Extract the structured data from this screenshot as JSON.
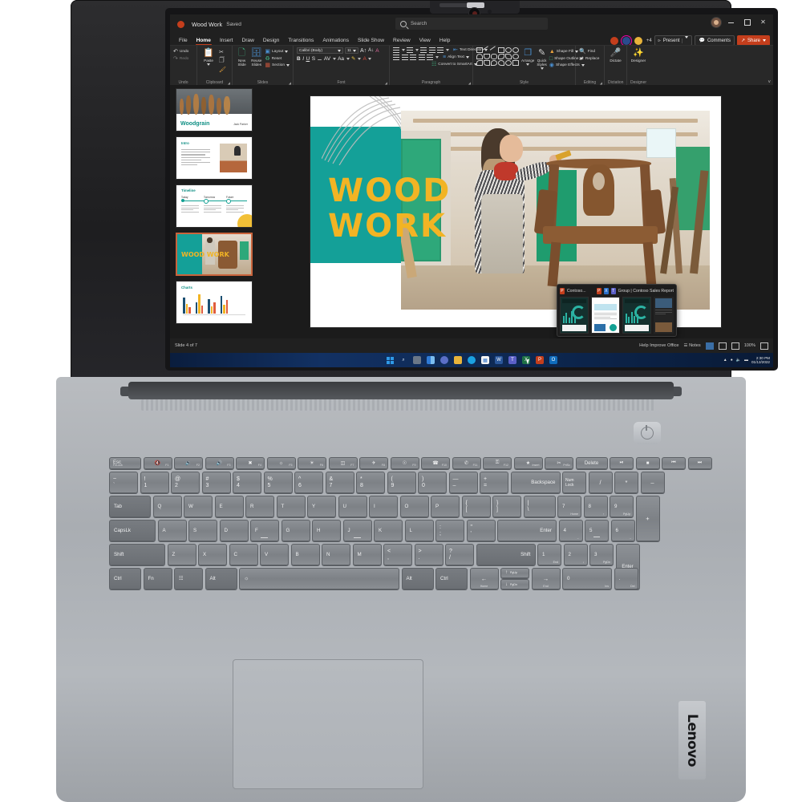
{
  "device": {
    "brand": "Lenovo",
    "webcam_icon": "webcam-icon",
    "power_button_icon": "power-icon"
  },
  "app": {
    "icon": "powerpoint-icon",
    "doc_title": "Wood Work",
    "save_state": "Saved",
    "search_placeholder": "Search",
    "search_icon": "search-icon",
    "window_controls": {
      "minimize": "–",
      "maximize": "□",
      "close": "×"
    },
    "account_avatar": "user-avatar"
  },
  "ribbon": {
    "tabs": [
      {
        "label": "File",
        "active": false
      },
      {
        "label": "Home",
        "active": true
      },
      {
        "label": "Insert",
        "active": false
      },
      {
        "label": "Draw",
        "active": false
      },
      {
        "label": "Design",
        "active": false
      },
      {
        "label": "Transitions",
        "active": false
      },
      {
        "label": "Animations",
        "active": false
      },
      {
        "label": "Slide Show",
        "active": false
      },
      {
        "label": "Review",
        "active": false
      },
      {
        "label": "View",
        "active": false
      },
      {
        "label": "Help",
        "active": false
      }
    ],
    "collab": {
      "avatar_count_extra": "+4",
      "present_label": "Present",
      "present_icon": "present-icon",
      "comments_label": "Comments",
      "comments_icon": "comment-icon",
      "share_label": "Share",
      "share_icon": "share-icon",
      "share_color": "#c43e1c"
    },
    "groups": [
      {
        "name": "Undo",
        "label": "Undo",
        "buttons": [
          {
            "label": "Undo",
            "icon": "undo-icon"
          },
          {
            "label": "Redo",
            "icon": "redo-icon"
          }
        ]
      },
      {
        "name": "Clipboard",
        "label": "Clipboard",
        "buttons": [
          {
            "label": "Paste",
            "icon": "paste-icon"
          },
          {
            "label": "Cut",
            "icon": "scissors-icon"
          },
          {
            "label": "Copy",
            "icon": "copy-icon"
          },
          {
            "label": "Format Painter",
            "icon": "format-painter-icon"
          }
        ]
      },
      {
        "name": "Slides",
        "label": "Slides",
        "buttons": [
          {
            "label": "New Slide",
            "icon": "new-slide-icon"
          },
          {
            "label": "Reuse Slides",
            "icon": "reuse-slides-icon"
          },
          {
            "label": "Layout",
            "icon": "layout-icon"
          },
          {
            "label": "Reset",
            "icon": "reset-icon"
          },
          {
            "label": "Section",
            "icon": "section-icon"
          }
        ]
      },
      {
        "name": "Font",
        "label": "Font",
        "font_name": "Calibri (Body)",
        "font_size": "11",
        "buttons": [
          {
            "label": "B",
            "icon": "bold-icon"
          },
          {
            "label": "I",
            "icon": "italic-icon"
          },
          {
            "label": "U",
            "icon": "underline-icon"
          },
          {
            "label": "S",
            "icon": "text-shadow-icon"
          },
          {
            "label": "abc",
            "icon": "strikethrough-icon"
          },
          {
            "label": "AV",
            "icon": "character-spacing-icon"
          },
          {
            "label": "Aa",
            "icon": "change-case-icon"
          },
          {
            "label": "A",
            "icon": "text-highlight-icon"
          },
          {
            "label": "A",
            "icon": "font-color-icon"
          },
          {
            "label": "A",
            "icon": "increase-font-size-icon"
          },
          {
            "label": "A",
            "icon": "decrease-font-size-icon"
          },
          {
            "label": "A",
            "icon": "clear-formatting-icon"
          }
        ]
      },
      {
        "name": "Paragraph",
        "label": "Paragraph",
        "buttons": [
          {
            "label": "Bullets",
            "icon": "bullets-icon"
          },
          {
            "label": "Numbering",
            "icon": "numbering-icon"
          },
          {
            "label": "Decrease Indent",
            "icon": "decrease-indent-icon"
          },
          {
            "label": "Increase Indent",
            "icon": "increase-indent-icon"
          },
          {
            "label": "Line Spacing",
            "icon": "line-spacing-icon"
          },
          {
            "label": "Text Direction",
            "icon": "text-direction-icon"
          },
          {
            "label": "Align Text",
            "icon": "align-text-icon"
          },
          {
            "label": "Convert to SmartArt",
            "icon": "smartart-icon"
          }
        ]
      },
      {
        "name": "Drawing",
        "label": "Style",
        "buttons": [
          {
            "label": "Arrange",
            "icon": "arrange-icon"
          },
          {
            "label": "Quick Styles",
            "icon": "quick-styles-icon"
          },
          {
            "label": "Shape Fill",
            "icon": "shape-fill-icon"
          },
          {
            "label": "Shape Outline",
            "icon": "shape-outline-icon"
          },
          {
            "label": "Shape Effects",
            "icon": "shape-effects-icon"
          }
        ]
      },
      {
        "name": "Editing",
        "label": "Editing",
        "buttons": [
          {
            "label": "Find",
            "icon": "find-icon"
          },
          {
            "label": "Replace",
            "icon": "replace-icon"
          }
        ]
      },
      {
        "name": "Dictation",
        "label": "Dictation",
        "buttons": [
          {
            "label": "Dictate",
            "icon": "microphone-icon"
          }
        ]
      },
      {
        "name": "Designer",
        "label": "Designer",
        "buttons": [
          {
            "label": "Designer",
            "icon": "designer-wand-icon"
          }
        ]
      }
    ]
  },
  "slides_panel": {
    "slides": [
      {
        "num": "1",
        "title": "Woodgrain",
        "byline": "Jack Parker",
        "selected": false,
        "kind": "cover"
      },
      {
        "num": "2",
        "title": "Intro",
        "selected": false,
        "kind": "text-image"
      },
      {
        "num": "3",
        "title": "Timeline",
        "milestones": [
          "Today",
          "Tomorrow",
          "Future"
        ],
        "selected": false,
        "kind": "timeline"
      },
      {
        "num": "4",
        "title": "WOOD WORK",
        "selected": true,
        "kind": "photo-title"
      },
      {
        "num": "5",
        "title": "Charts",
        "selected": false,
        "kind": "charts"
      }
    ]
  },
  "slide": {
    "title_line1": "WOOD",
    "title_line2": "WORK",
    "title_color": "#f2b424",
    "accent_color": "#14a098",
    "photo_alt": "woman-sanding-wooden-chair-in-workshop"
  },
  "taskbar_preview": {
    "window1_label": "Contoso...",
    "window1_icon": "powerpoint-icon",
    "window2_label": "Group | Contoso Sales Report",
    "window2_icons": [
      "powerpoint-icon",
      "excel-icon",
      "teams-icon"
    ]
  },
  "status_bar": {
    "slide_counter": "Slide 4 of 7",
    "help_improve": "Help Improve Office",
    "notes_label": "Notes",
    "notes_icon": "notes-icon",
    "zoom_level": "100%",
    "views": [
      {
        "name": "normal-view",
        "icon": "normal-view-icon",
        "active": true
      },
      {
        "name": "slide-sorter-view",
        "icon": "slide-sorter-icon",
        "active": false
      },
      {
        "name": "reading-view",
        "icon": "reading-view-icon",
        "active": false
      }
    ],
    "fit_icon": "fit-to-window-icon"
  },
  "windows_taskbar": {
    "items": [
      {
        "name": "start-button",
        "icon": "windows-logo-icon"
      },
      {
        "name": "search-button",
        "icon": "search-icon"
      },
      {
        "name": "task-view-button",
        "icon": "task-view-icon"
      },
      {
        "name": "widgets-button",
        "icon": "widgets-icon"
      },
      {
        "name": "chat-button",
        "icon": "chat-icon"
      },
      {
        "name": "file-explorer",
        "icon": "folder-icon"
      },
      {
        "name": "microsoft-edge",
        "icon": "edge-icon"
      },
      {
        "name": "microsoft-store",
        "icon": "store-icon"
      },
      {
        "name": "word",
        "icon": "word-icon"
      },
      {
        "name": "teams",
        "icon": "teams-icon"
      },
      {
        "name": "excel",
        "icon": "excel-icon"
      },
      {
        "name": "powerpoint",
        "icon": "powerpoint-icon"
      },
      {
        "name": "outlook",
        "icon": "outlook-icon"
      }
    ],
    "tray": [
      {
        "name": "show-hidden-icons",
        "icon": "chevron-up-icon"
      },
      {
        "name": "network",
        "icon": "wifi-icon"
      },
      {
        "name": "volume",
        "icon": "speaker-icon"
      },
      {
        "name": "battery",
        "icon": "battery-icon"
      }
    ],
    "time": "2:30 PM",
    "date": "01/12/2022"
  },
  "keyboard": {
    "fn_row": [
      {
        "main": "Esc",
        "sub": "FnLock",
        "type": "esc"
      },
      {
        "icon": "mute-icon",
        "fn": "F1"
      },
      {
        "icon": "volume-down-icon",
        "fn": "F2"
      },
      {
        "icon": "volume-up-icon",
        "fn": "F3"
      },
      {
        "icon": "mic-mute-icon",
        "fn": "F4"
      },
      {
        "icon": "brightness-down-icon",
        "fn": "F5"
      },
      {
        "icon": "brightness-up-icon",
        "fn": "F6"
      },
      {
        "icon": "project-display-icon",
        "fn": "F7"
      },
      {
        "icon": "airplane-mode-icon",
        "fn": "F8"
      },
      {
        "icon": "notifications-icon",
        "fn": "F9"
      },
      {
        "icon": "answer-call-icon",
        "fn": "F10"
      },
      {
        "icon": "end-call-icon",
        "fn": "F11"
      },
      {
        "icon": "lock-icon",
        "fn": "F12"
      },
      {
        "icon": "favorites-icon",
        "fn": "Insert"
      },
      {
        "icon": "snipping-tool-icon",
        "fn": "PrtSc"
      },
      {
        "main": "Delete",
        "type": "word"
      },
      {
        "icon": "play-pause-icon"
      },
      {
        "icon": "stop-icon"
      },
      {
        "icon": "previous-track-icon"
      },
      {
        "icon": "next-track-icon"
      }
    ],
    "number_row": [
      {
        "up": "~",
        "dn": "`"
      },
      {
        "up": "!",
        "dn": "1"
      },
      {
        "up": "@",
        "dn": "2"
      },
      {
        "up": "#",
        "dn": "3"
      },
      {
        "up": "$",
        "dn": "4"
      },
      {
        "up": "%",
        "dn": "5"
      },
      {
        "up": "^",
        "dn": "6"
      },
      {
        "up": "&",
        "dn": "7"
      },
      {
        "up": "*",
        "dn": "8"
      },
      {
        "up": "(",
        "dn": "9"
      },
      {
        "up": ")",
        "dn": "0"
      },
      {
        "up": "—",
        "dn": "–"
      },
      {
        "up": "+",
        "dn": "="
      },
      {
        "main": "Backspace",
        "type": "wide-right"
      },
      {
        "up": "Num",
        "dn": "Lock",
        "type": "stacked-small"
      },
      {
        "main": "/"
      },
      {
        "main": "*"
      },
      {
        "main": "–"
      }
    ],
    "qwerty_row": [
      {
        "main": "Tab",
        "type": "left"
      },
      {
        "main": "Q"
      },
      {
        "main": "W"
      },
      {
        "main": "E"
      },
      {
        "main": "R"
      },
      {
        "main": "T"
      },
      {
        "main": "Y"
      },
      {
        "main": "U"
      },
      {
        "main": "I"
      },
      {
        "main": "O"
      },
      {
        "main": "P"
      },
      {
        "up": "{",
        "dn": "["
      },
      {
        "up": "}",
        "dn": "]"
      },
      {
        "up": "|",
        "dn": "\\"
      },
      {
        "main": "7",
        "sub": "Home"
      },
      {
        "main": "8",
        "sub": "↑"
      },
      {
        "main": "9",
        "sub": "PgUp"
      },
      {
        "main": "+",
        "type": "tall"
      }
    ],
    "home_row": [
      {
        "main": "CapsLk",
        "type": "left"
      },
      {
        "main": "A"
      },
      {
        "main": "S"
      },
      {
        "main": "D"
      },
      {
        "main": "F"
      },
      {
        "main": "G"
      },
      {
        "main": "H"
      },
      {
        "main": "J"
      },
      {
        "main": "K"
      },
      {
        "main": "L"
      },
      {
        "up": ":",
        "dn": ";"
      },
      {
        "up": "\"",
        "dn": "'"
      },
      {
        "main": "Enter",
        "type": "wide-right"
      },
      {
        "main": "4",
        "sub": "←"
      },
      {
        "main": "5",
        "sub": ""
      },
      {
        "main": "6",
        "sub": "→"
      }
    ],
    "shift_row": [
      {
        "main": "Shift",
        "type": "left"
      },
      {
        "main": "Z"
      },
      {
        "main": "X"
      },
      {
        "main": "C"
      },
      {
        "main": "V"
      },
      {
        "main": "B"
      },
      {
        "main": "N"
      },
      {
        "main": "M"
      },
      {
        "up": "<",
        "dn": ","
      },
      {
        "up": ">",
        "dn": "."
      },
      {
        "up": "?",
        "dn": "/"
      },
      {
        "main": "Shift",
        "type": "wide-right"
      },
      {
        "main": "1",
        "sub": "End"
      },
      {
        "main": "2",
        "sub": "↓"
      },
      {
        "main": "3",
        "sub": "PgDn"
      },
      {
        "main": "Enter",
        "type": "tall"
      }
    ],
    "bottom_row": [
      {
        "main": "Ctrl"
      },
      {
        "main": "Fn"
      },
      {
        "icon": "windows-logo-icon"
      },
      {
        "main": "Alt"
      },
      {
        "icon": "keyboard-backlight-icon",
        "type": "space"
      },
      {
        "main": "Alt"
      },
      {
        "main": "Ctrl"
      },
      {
        "main": "←",
        "sub": "Home"
      },
      {
        "main": "↑",
        "sub": "PgUp",
        "type": "half-up"
      },
      {
        "main": "↓",
        "sub": "PgDn",
        "type": "half-dn"
      },
      {
        "main": "→",
        "sub": "End"
      },
      {
        "main": "0",
        "sub": "Ins",
        "type": "wide-num"
      },
      {
        "main": ".",
        "sub": "Del"
      }
    ]
  }
}
